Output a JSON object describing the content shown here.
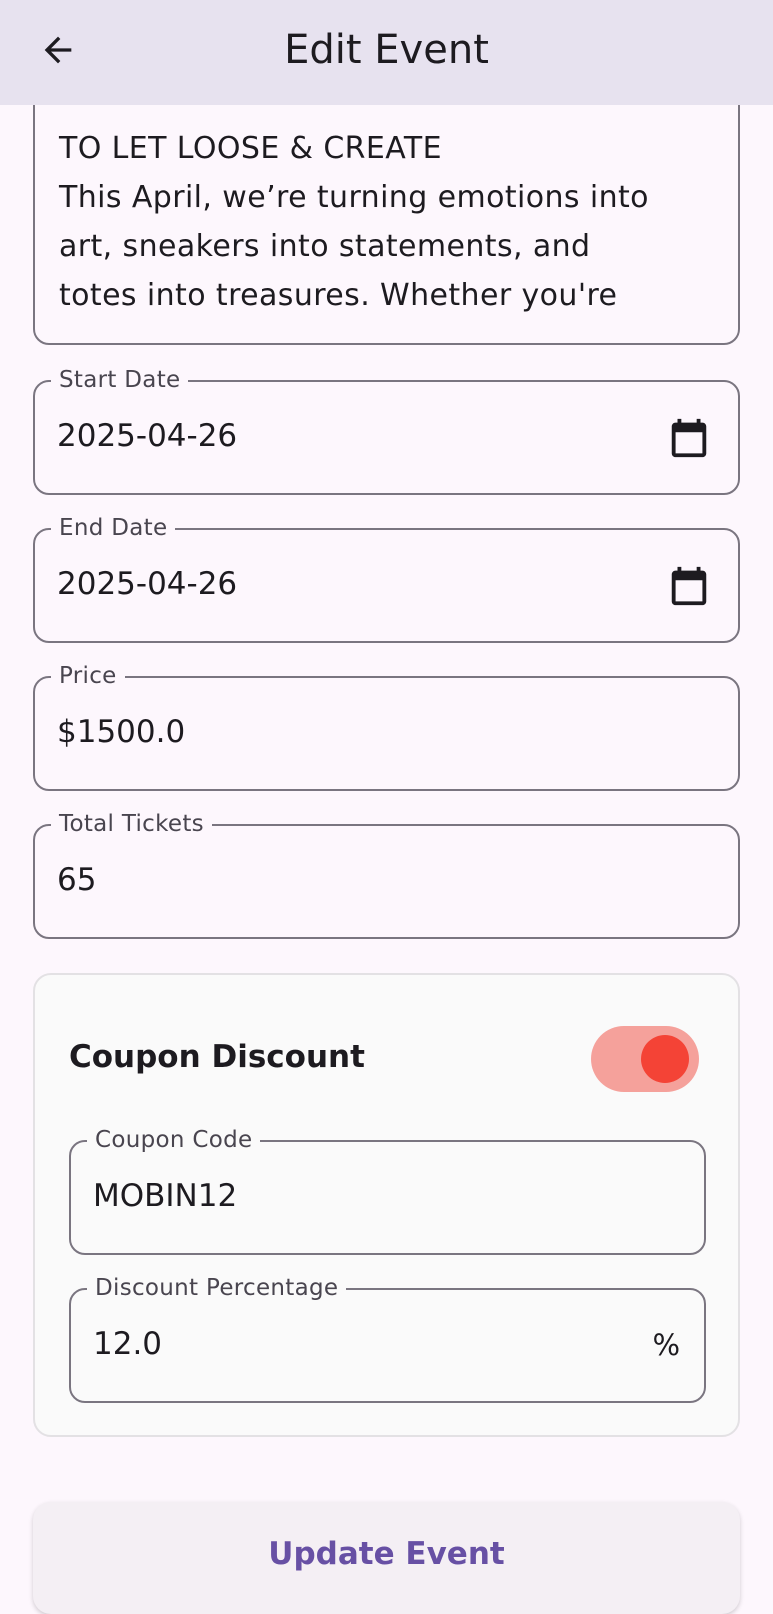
{
  "header": {
    "title": "Edit Event",
    "back_icon": "arrow-back-icon"
  },
  "description": {
    "lines": [
      "TO LET LOOSE & CREATE",
      "This April, we’re turning emotions into",
      "art, sneakers into statements, and",
      "totes into treasures. Whether you're"
    ]
  },
  "fields": {
    "start_date": {
      "label": "Start Date",
      "value": "2025-04-26",
      "icon": "calendar-icon"
    },
    "end_date": {
      "label": "End Date",
      "value": "2025-04-26",
      "icon": "calendar-icon"
    },
    "price": {
      "label": "Price",
      "value": "$1500.0"
    },
    "total_tickets": {
      "label": "Total Tickets",
      "value": "65"
    }
  },
  "coupon": {
    "title": "Coupon Discount",
    "enabled": true,
    "code": {
      "label": "Coupon Code",
      "value": "MOBIN12"
    },
    "discount": {
      "label": "Discount Percentage",
      "value": "12.0",
      "suffix": "%"
    }
  },
  "actions": {
    "update_label": "Update Event"
  },
  "colors": {
    "appbar": "#e7e2ef",
    "accent": "#6750a4",
    "toggle_track": "#f5a19b",
    "toggle_thumb": "#f44336"
  }
}
